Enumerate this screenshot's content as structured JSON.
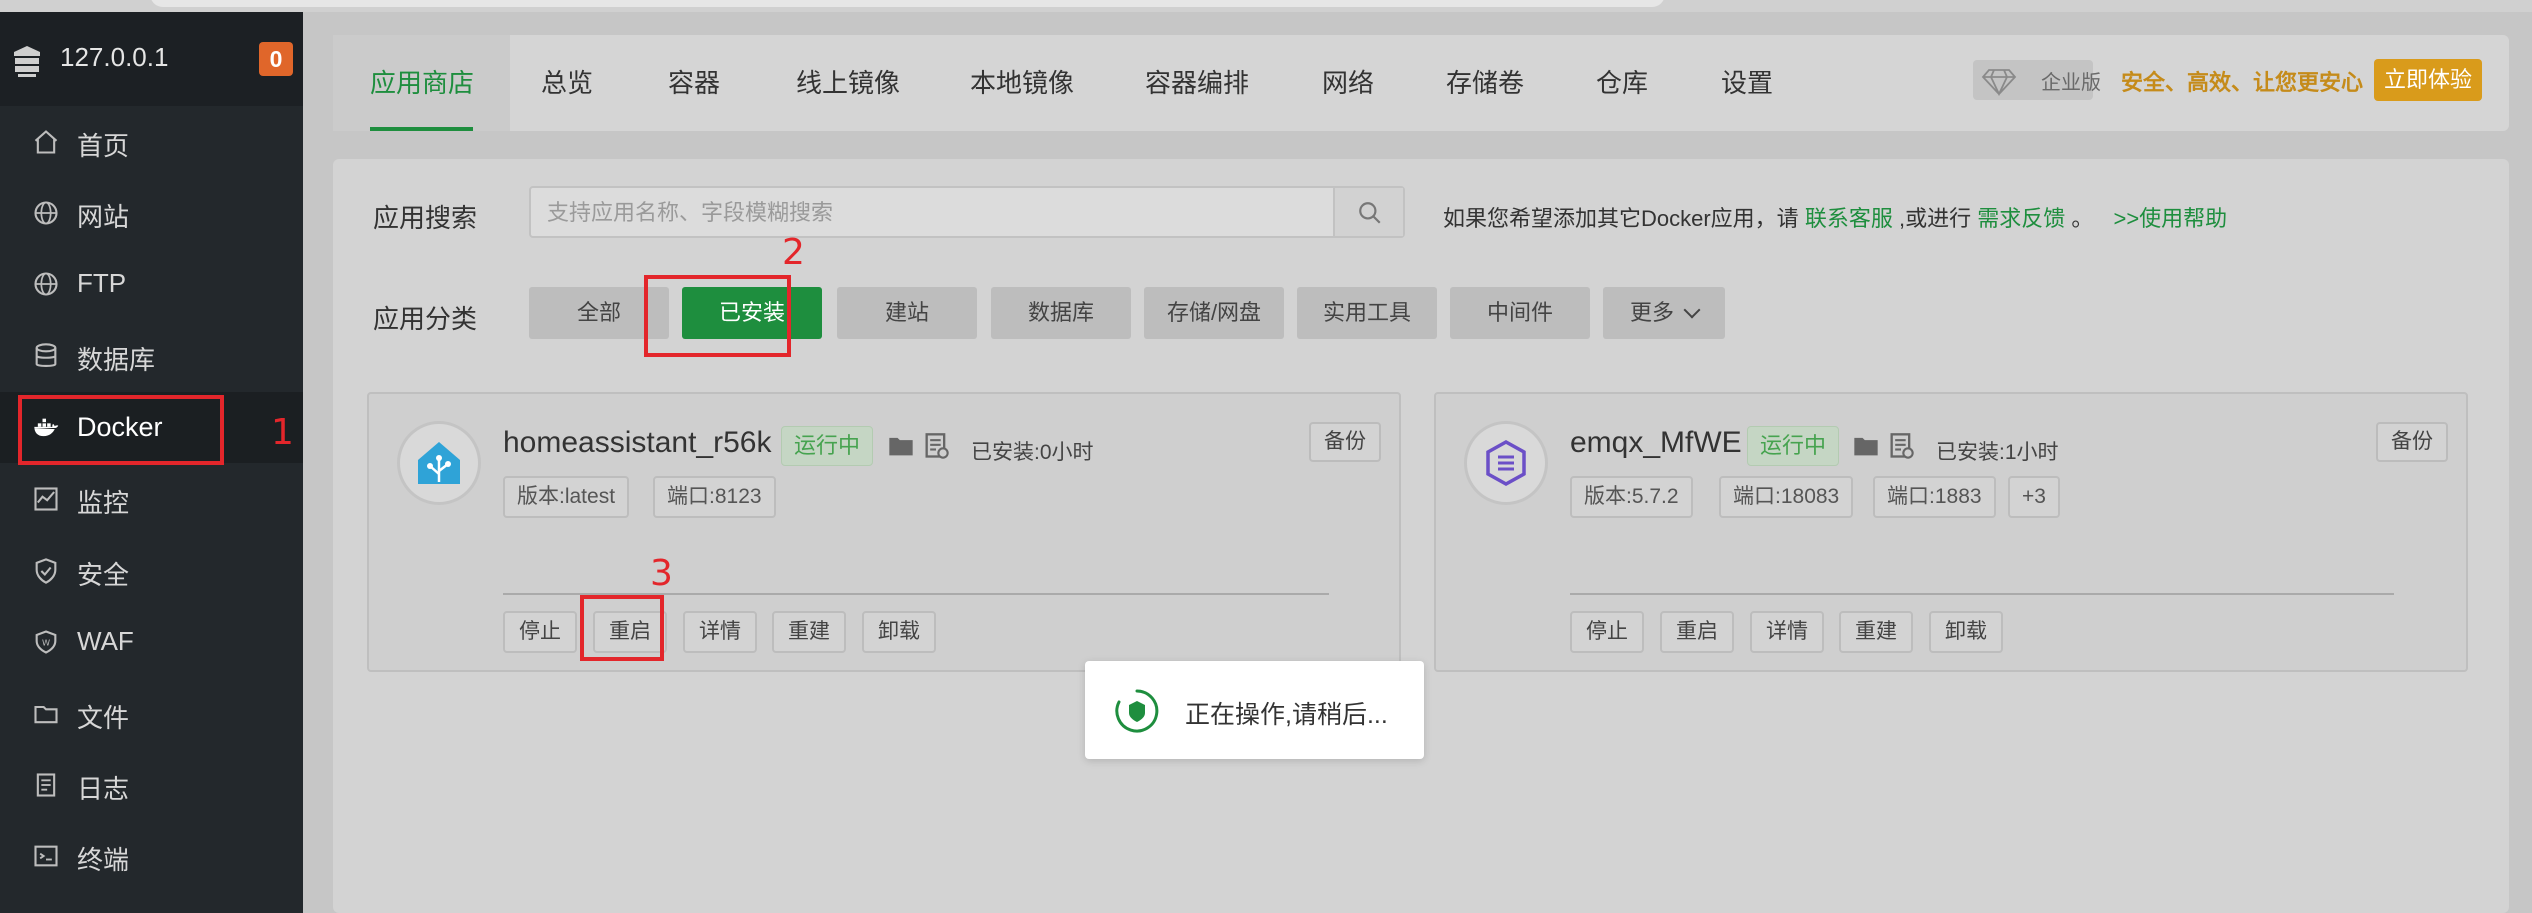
{
  "sidebar": {
    "host": "127.0.0.1",
    "badge": "0",
    "items": [
      {
        "label": "首页",
        "icon": "home-icon"
      },
      {
        "label": "网站",
        "icon": "globe-icon"
      },
      {
        "label": "FTP",
        "icon": "globe-icon"
      },
      {
        "label": "数据库",
        "icon": "database-icon"
      },
      {
        "label": "Docker",
        "icon": "docker-icon"
      },
      {
        "label": "监控",
        "icon": "monitor-icon"
      },
      {
        "label": "安全",
        "icon": "shield-icon"
      },
      {
        "label": "WAF",
        "icon": "waf-icon"
      },
      {
        "label": "文件",
        "icon": "folder-icon"
      },
      {
        "label": "日志",
        "icon": "log-icon"
      },
      {
        "label": "终端",
        "icon": "terminal-icon"
      }
    ]
  },
  "tabs": [
    {
      "label": "应用商店"
    },
    {
      "label": "总览"
    },
    {
      "label": "容器"
    },
    {
      "label": "线上镜像"
    },
    {
      "label": "本地镜像"
    },
    {
      "label": "容器编排"
    },
    {
      "label": "网络"
    },
    {
      "label": "存储卷"
    },
    {
      "label": "仓库"
    },
    {
      "label": "设置"
    }
  ],
  "enterprise": {
    "badge": "企业版",
    "slogan": "安全、高效、让您更安心",
    "button": "立即体验"
  },
  "search": {
    "label": "应用搜索",
    "placeholder": "支持应用名称、字段模糊搜索",
    "help_prefix": "如果您希望添加其它Docker应用，请",
    "help_contact": "联系客服",
    "help_mid": ",或进行",
    "help_feedback": "需求反馈",
    "help_suffix": "。",
    "help_link": ">>使用帮助"
  },
  "category": {
    "label": "应用分类",
    "items": [
      "全部",
      "已安装",
      "建站",
      "数据库",
      "存储/网盘",
      "实用工具",
      "中间件",
      "更多"
    ]
  },
  "apps": [
    {
      "name": "homeassistant_r56k",
      "status": "运行中",
      "installed": "已安装:0小时",
      "backup": "备份",
      "tags": [
        "版本:latest",
        "端口:8123"
      ],
      "actions": [
        "停止",
        "重启",
        "详情",
        "重建",
        "卸载"
      ]
    },
    {
      "name": "emqx_MfWE",
      "status": "运行中",
      "installed": "已安装:1小时",
      "backup": "备份",
      "tags": [
        "版本:5.7.2",
        "端口:18083",
        "端口:1883",
        "+3"
      ],
      "actions": [
        "停止",
        "重启",
        "详情",
        "重建",
        "卸载"
      ]
    }
  ],
  "toast": {
    "message": "正在操作,请稍后..."
  },
  "annotations": [
    "1",
    "2",
    "3"
  ],
  "colors": {
    "accent": "#1e8e3e",
    "annotation": "#e3262b",
    "enterprise": "#d99b1b"
  }
}
